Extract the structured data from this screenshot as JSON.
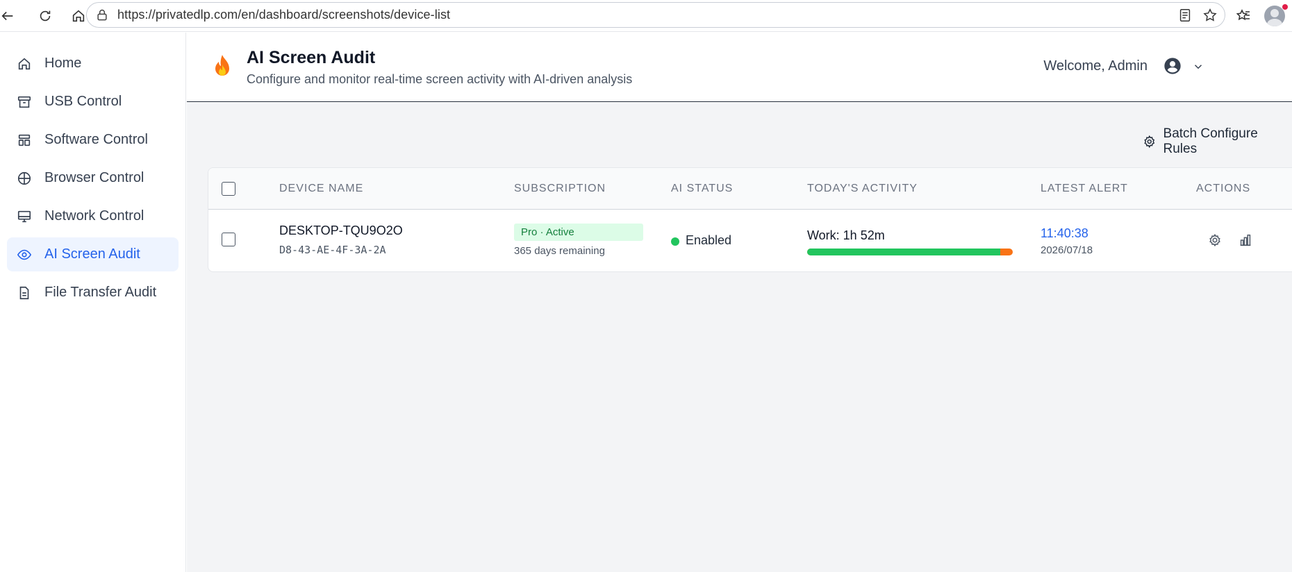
{
  "browser": {
    "url": "https://privatedlp.com/en/dashboard/screenshots/device-list"
  },
  "sidebar": {
    "items": [
      {
        "label": "Home",
        "icon": "home-icon"
      },
      {
        "label": "USB Control",
        "icon": "archive-icon"
      },
      {
        "label": "Software Control",
        "icon": "layout-icon"
      },
      {
        "label": "Browser Control",
        "icon": "globe-icon"
      },
      {
        "label": "Network Control",
        "icon": "monitor-icon"
      },
      {
        "label": "AI Screen Audit",
        "icon": "eye-icon",
        "active": true
      },
      {
        "label": "File Transfer Audit",
        "icon": "document-icon"
      }
    ]
  },
  "header": {
    "title": "AI Screen Audit",
    "subtitle": "Configure and monitor real-time screen activity with AI-driven analysis",
    "welcome": "Welcome, Admin"
  },
  "toolbar": {
    "batch_label": "Batch Configure Rules"
  },
  "table": {
    "columns": [
      "DEVICE NAME",
      "SUBSCRIPTION",
      "AI STATUS",
      "TODAY'S ACTIVITY",
      "LATEST ALERT",
      "ACTIONS"
    ],
    "rows": [
      {
        "device_name": "DESKTOP-TQU9O2O",
        "mac": "D8-43-AE-4F-3A-2A",
        "subscription": "Pro · Active",
        "days_remaining": "365 days remaining",
        "ai_status": "Enabled",
        "activity": "Work: 1h 52m",
        "work_fraction": 0.94,
        "alert_time": "11:40:38",
        "alert_date": "2026/07/18"
      }
    ]
  },
  "colors": {
    "accent": "#2563eb",
    "active_bg": "#eef4ff",
    "success": "#22c55e",
    "warning": "#f97316",
    "badge_bg": "#dcfce7",
    "badge_text": "#15803d"
  }
}
